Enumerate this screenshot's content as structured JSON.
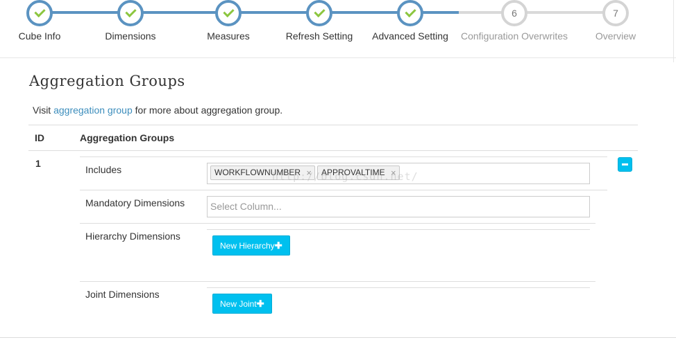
{
  "wizard": {
    "steps": [
      {
        "label": "Cube Info",
        "state": "done"
      },
      {
        "label": "Dimensions",
        "state": "done"
      },
      {
        "label": "Measures",
        "state": "done"
      },
      {
        "label": "Refresh Setting",
        "state": "done"
      },
      {
        "label": "Advanced Setting",
        "state": "done"
      },
      {
        "label": "Configuration Overwrites",
        "state": "todo",
        "number": "6"
      },
      {
        "label": "Overview",
        "state": "todo",
        "number": "7"
      }
    ]
  },
  "page": {
    "title": "Aggregation Groups",
    "intro_prefix": "Visit",
    "intro_link": "aggregation group",
    "intro_suffix": "for more about aggregation group."
  },
  "table": {
    "headers": {
      "id": "ID",
      "groups": "Aggregation Groups"
    },
    "row": {
      "id": "1",
      "includes_label": "Includes",
      "includes_tags": [
        "WORKFLOWNUMBER",
        "APPROVALTIME"
      ],
      "mandatory_label": "Mandatory Dimensions",
      "mandatory_placeholder": "Select Column...",
      "hierarchy_label": "Hierarchy Dimensions",
      "new_hierarchy_label": "New Hierarchy",
      "joint_label": "Joint Dimensions",
      "new_joint_label": "New Joint"
    }
  },
  "icons": {
    "check": "check-icon",
    "remove_tag": "×",
    "plus": "✚",
    "minus": "minus-icon"
  },
  "watermark": "http://blog.csdn.net/",
  "colors": {
    "accent_blue": "#5b93c1",
    "check_green": "#8cc63f",
    "button": "#00c0ef",
    "link": "#3c8dbc",
    "pending": "#d4d4d4"
  }
}
